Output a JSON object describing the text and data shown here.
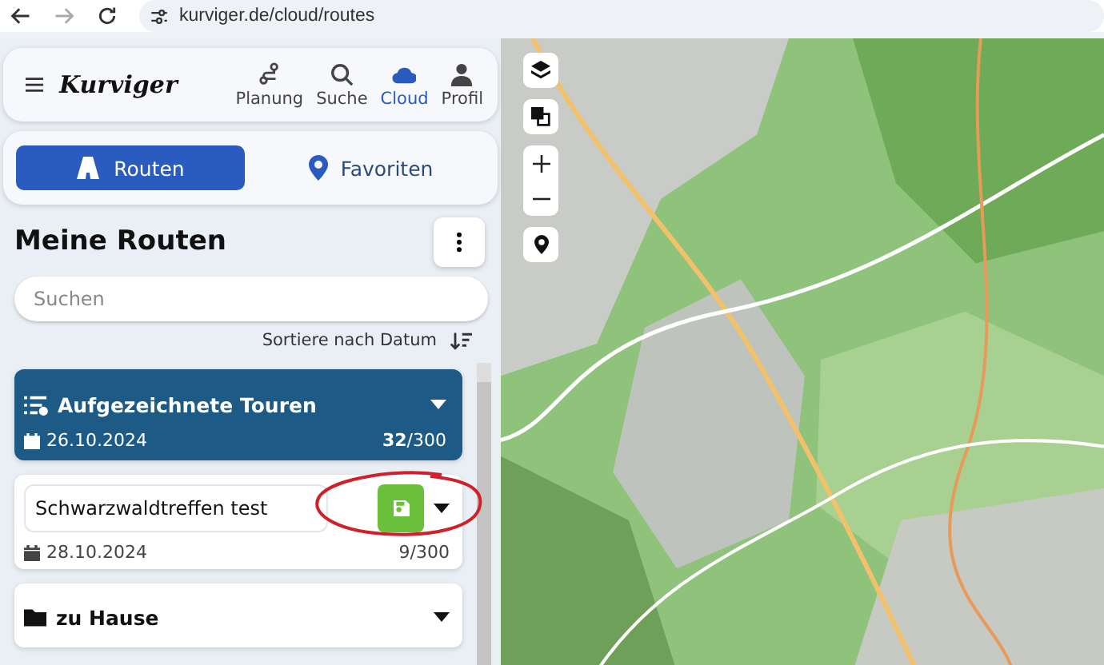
{
  "browser": {
    "url": "kurviger.de/cloud/routes"
  },
  "header": {
    "logo": "Kurviger",
    "nav": [
      {
        "kind": "route",
        "label": "Planung",
        "selected": false
      },
      {
        "kind": "search",
        "label": "Suche",
        "selected": false
      },
      {
        "kind": "cloud",
        "label": "Cloud",
        "selected": true
      },
      {
        "kind": "user",
        "label": "Profil",
        "selected": false
      }
    ]
  },
  "tabs": [
    {
      "kind": "road",
      "label": "Routen",
      "selected": true
    },
    {
      "kind": "pin",
      "label": "Favoriten",
      "selected": false
    }
  ],
  "title": "Meine Routen",
  "search": {
    "placeholder": "Suchen"
  },
  "sort": {
    "label": "Sortiere nach Datum"
  },
  "items": [
    {
      "kind": "recorded",
      "name": "Aufgezeichnete Touren",
      "date": "26.10.2024",
      "count": "**32**/300",
      "selected": true
    },
    {
      "kind": "editing",
      "name": "Schwarzwaldtreffen test",
      "date": "28.10.2024",
      "count": "9/300",
      "selected": false
    },
    {
      "kind": "folder",
      "name": "zu Hause",
      "selected": false
    }
  ]
}
